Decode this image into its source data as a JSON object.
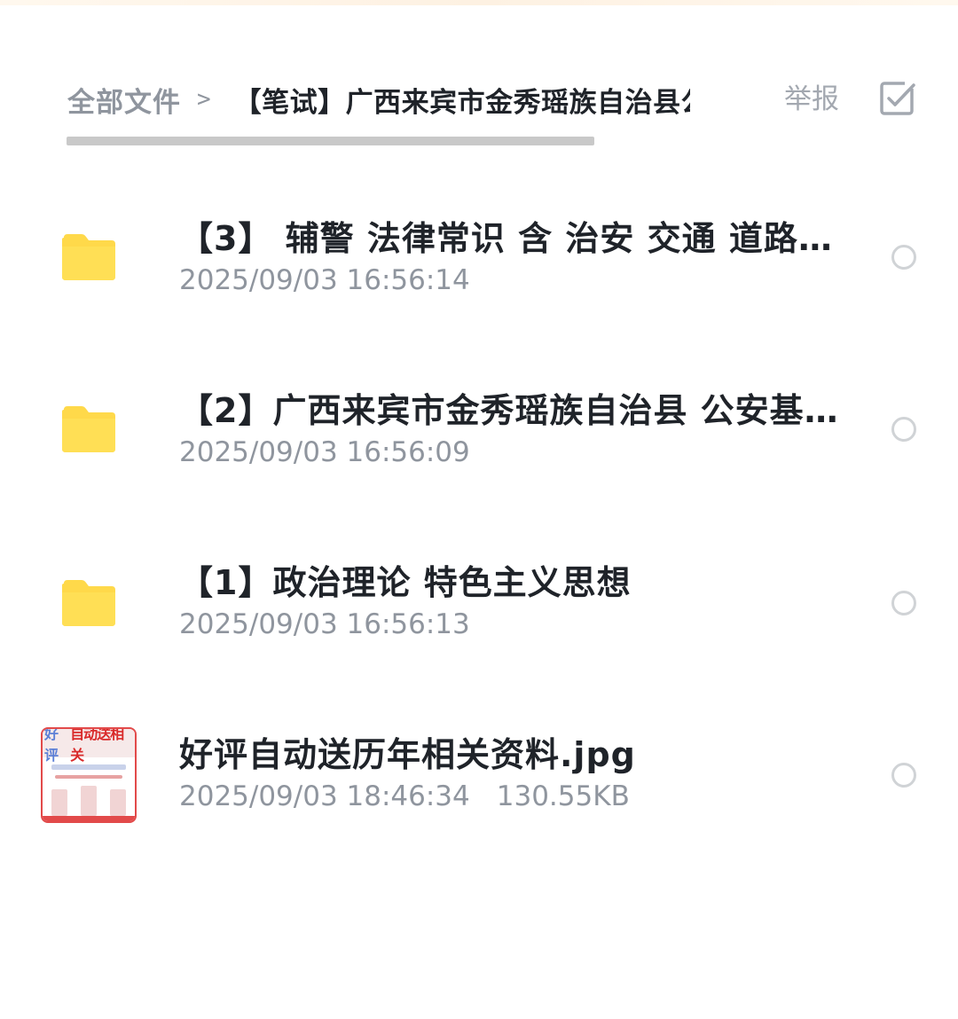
{
  "breadcrumb": {
    "root": "全部文件",
    "separator": ">",
    "current": "【笔试】广西来宾市金秀瑶族自治县公安基"
  },
  "header": {
    "report_label": "举报",
    "multi_select_icon": "checkbox-icon"
  },
  "files": [
    {
      "type": "folder",
      "icon": "folder-icon",
      "name": "【3】 辅警 法律常识 含 治安 交通 道路…",
      "modified": "2025/09/03 16:56:14",
      "size": ""
    },
    {
      "type": "folder",
      "icon": "folder-icon",
      "name": "【2】广西来宾市金秀瑶族自治县 公安基…",
      "modified": "2025/09/03 16:56:09",
      "size": ""
    },
    {
      "type": "folder",
      "icon": "folder-icon",
      "name": "【1】政治理论 特色主义思想",
      "modified": "2025/09/03 16:56:13",
      "size": ""
    },
    {
      "type": "image",
      "icon": "image-thumbnail",
      "name": "好评自动送历年相关资料.jpg",
      "modified": "2025/09/03 18:46:34",
      "size": "130.55KB",
      "thumb_text_a": "好评",
      "thumb_text_b": "自动送相关"
    }
  ],
  "colors": {
    "folder": "#ffd94a",
    "text_primary": "#1f2329",
    "text_secondary": "#8f959e",
    "radio_border": "#d0d3d6",
    "thumb_accent": "#e24a4a"
  }
}
